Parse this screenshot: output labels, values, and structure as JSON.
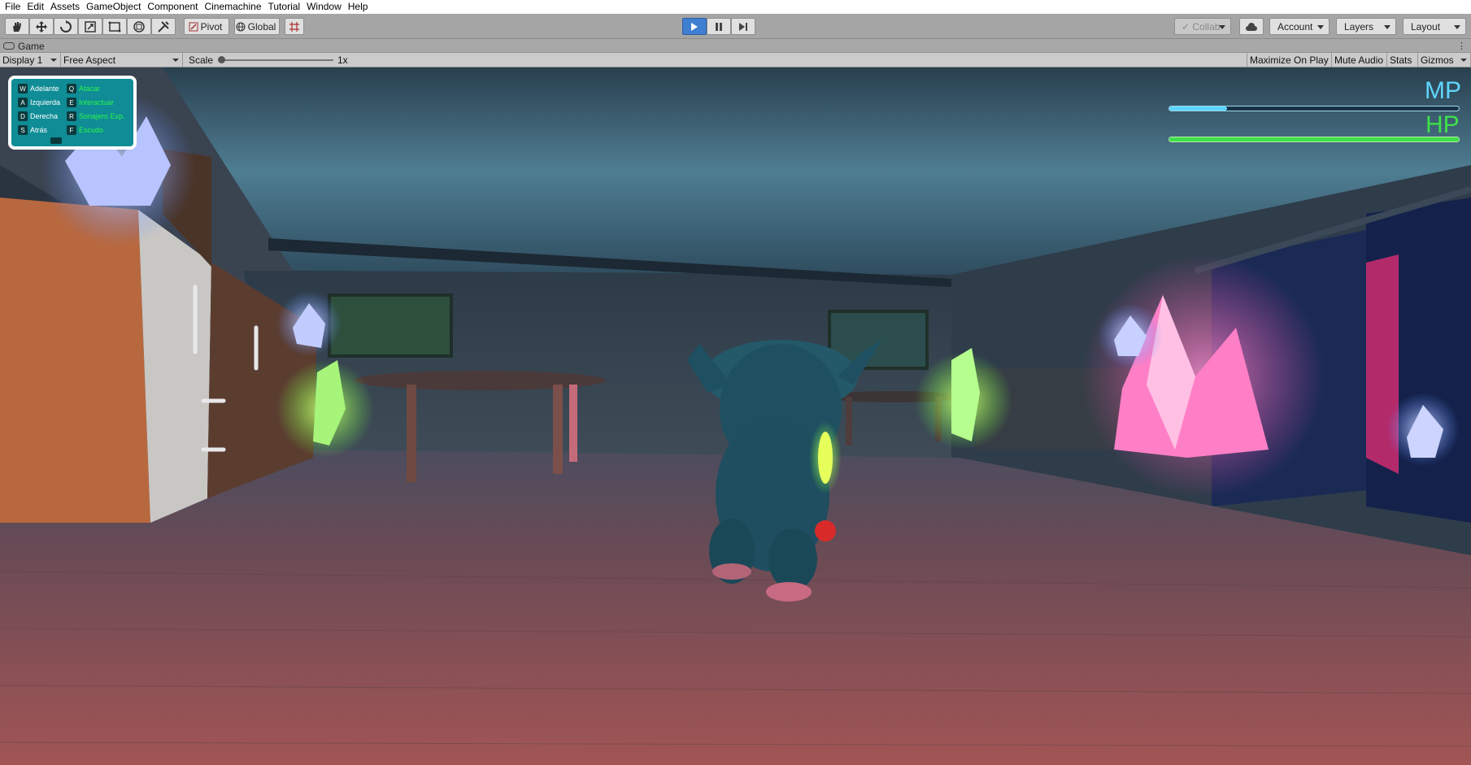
{
  "menu": [
    "File",
    "Edit",
    "Assets",
    "GameObject",
    "Component",
    "Cinemachine",
    "Tutorial",
    "Window",
    "Help"
  ],
  "toolbar": {
    "pivot": "Pivot",
    "global": "Global",
    "collab": "Collab",
    "account": "Account",
    "layers": "Layers",
    "layout": "Layout"
  },
  "tab": {
    "title": "Game"
  },
  "game_view": {
    "display": "Display 1",
    "aspect": "Free Aspect",
    "scale_label": "Scale",
    "scale_value": "1x",
    "maximize": "Maximize On Play",
    "mute": "Mute Audio",
    "stats": "Stats",
    "gizmos": "Gizmos"
  },
  "controls": [
    {
      "key": "W",
      "label": "Adelante",
      "color": "white"
    },
    {
      "key": "A",
      "label": "Izquierda",
      "color": "white"
    },
    {
      "key": "D",
      "label": "Derecha",
      "color": "white"
    },
    {
      "key": "S",
      "label": "Atrás",
      "color": "white"
    },
    {
      "key": "Q",
      "label": "Atacar",
      "color": "green"
    },
    {
      "key": "E",
      "label": "Interactuar",
      "color": "green"
    },
    {
      "key": "R",
      "label": "Sonajero Exp.",
      "color": "green"
    },
    {
      "key": "F",
      "label": "Escudo",
      "color": "green"
    }
  ],
  "hud": {
    "mp_label": "MP",
    "hp_label": "HP",
    "mp_fill": 0.2,
    "hp_fill": 1.0,
    "mp_color": "#5fd6ff",
    "hp_color": "#3ee04a"
  }
}
